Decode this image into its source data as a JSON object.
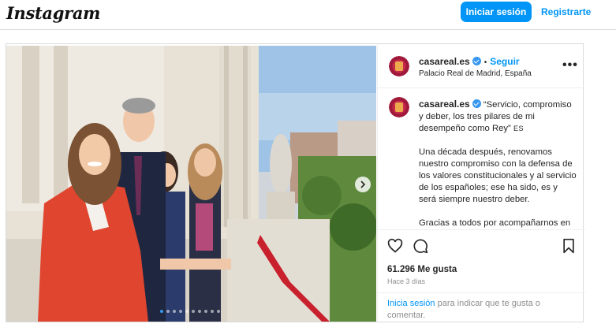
{
  "header": {
    "logo": "Instagram",
    "login_label": "Iniciar sesión",
    "register_label": "Registrarte"
  },
  "post": {
    "username": "casareal.es",
    "separator": "•",
    "follow_label": "Seguir",
    "location": "Palacio Real de Madrid, España",
    "more_label": "•••",
    "caption": {
      "p1": "“Servicio, compromiso y deber, los tres pilares de mi desempeño como Rey” ",
      "flag": "ES",
      "p2": "Una década después, renovamos nuestro compromiso con la defensa de los valores constitucionales y al servicio de los españoles; ese ha sido, es y será siempre nuestro deber.",
      "p3": "Gracias a todos por acompañarnos en un día tan especial."
    },
    "likes": "61.296 Me gusta",
    "time": "Hace 3 días",
    "login_prompt": {
      "link": "Inicia sesión",
      "text": " para indicar que te gusta o comentar."
    },
    "carousel": {
      "total": 10,
      "active": 1
    }
  },
  "icons": {
    "like": "heart-icon",
    "comment": "comment-icon",
    "save": "bookmark-icon",
    "next": "chevron-right-icon",
    "verified": "verified-badge-icon"
  },
  "colors": {
    "accent": "#0095f6",
    "text": "#262626",
    "muted": "#8e8e8e",
    "border": "#dbdbdb"
  }
}
